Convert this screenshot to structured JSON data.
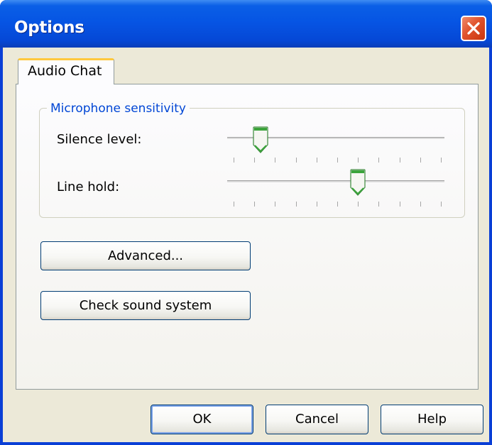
{
  "window": {
    "title": "Options",
    "close_icon": "close-icon"
  },
  "tabs": [
    {
      "label": "Audio Chat",
      "selected": true
    }
  ],
  "mic_group": {
    "legend": "Microphone sensitivity",
    "silence": {
      "label": "Silence level:",
      "value_fraction": 0.13,
      "tick_count": 11
    },
    "line_hold": {
      "label": "Line hold:",
      "value_fraction": 0.6,
      "tick_count": 11
    }
  },
  "buttons": {
    "advanced": "Advanced...",
    "check_sound": "Check sound system",
    "ok": "OK",
    "cancel": "Cancel",
    "help": "Help"
  },
  "colors": {
    "title_bar": "#0655E4",
    "group_legend": "#0046D5",
    "dialog_bg": "#ECE9D8",
    "tab_highlight": "#FFC83C",
    "thumb_green": "#3BA43B"
  }
}
